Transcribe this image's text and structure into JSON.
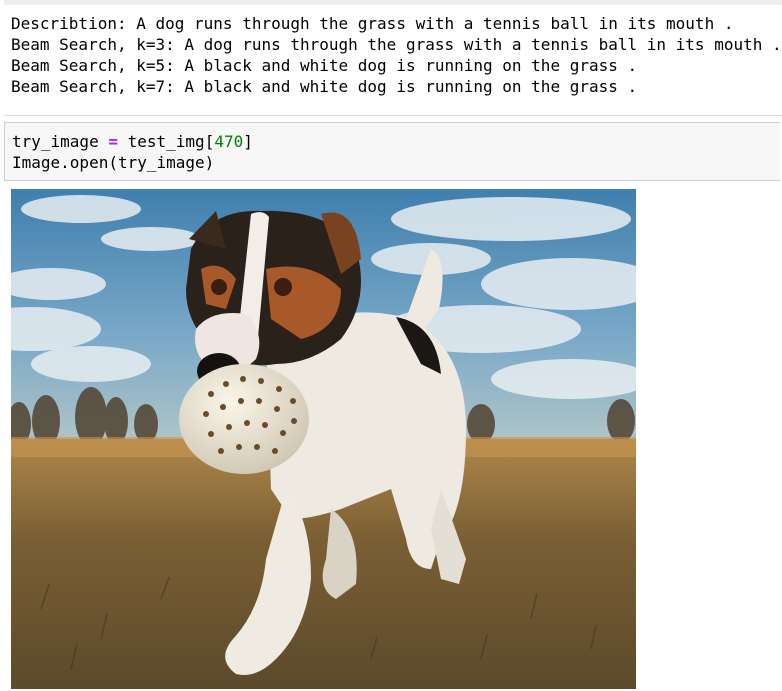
{
  "output": {
    "lines": [
      "Describtion: A dog runs through the grass with a tennis ball in its mouth .",
      "Beam Search, k=3: A dog runs through the grass with a tennis ball in its mouth .",
      "Beam Search, k=5: A black and white dog is running on the grass .",
      "Beam Search, k=7: A black and white dog is running on the grass ."
    ]
  },
  "input_cell": {
    "line1": {
      "var": "try_image",
      "op": "=",
      "expr": "test_img",
      "open": "[",
      "index": "470",
      "close": "]"
    },
    "line2": "Image.open(try_image)"
  },
  "image": {
    "subject": "jack-russell-dog-with-ball-photo",
    "colors": {
      "sky": "#5f95bf",
      "cloud": "#e8eef2",
      "grass": "#8a6d3c",
      "dog_white": "#eeeae2",
      "dog_brown": "#8a4b1e"
    }
  }
}
